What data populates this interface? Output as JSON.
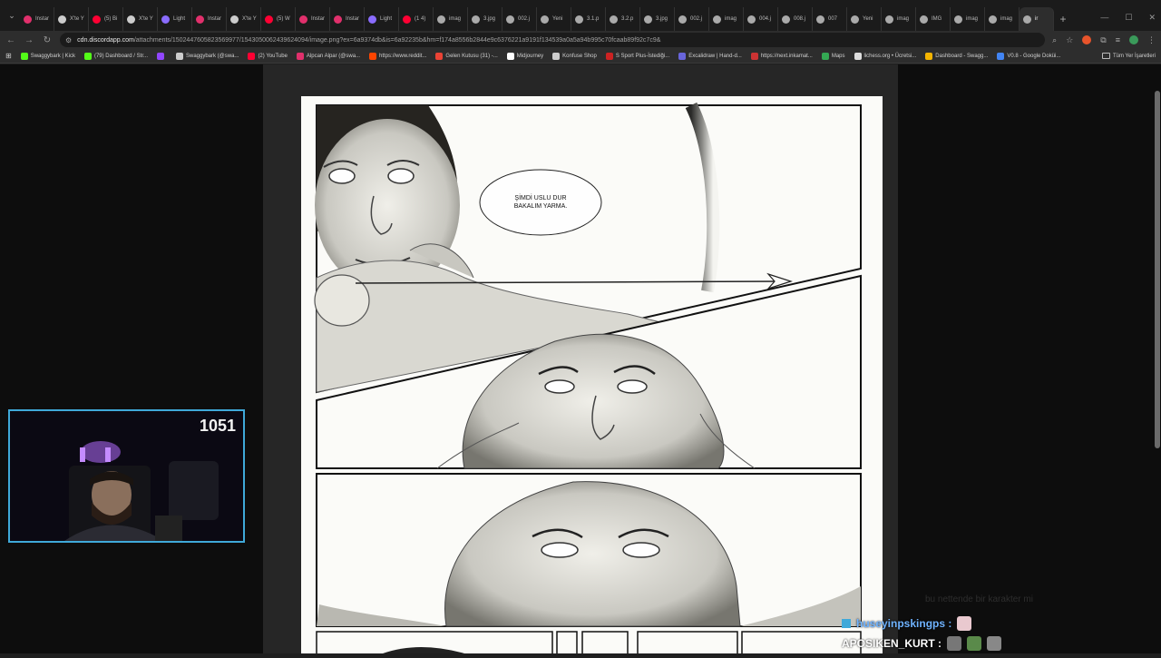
{
  "tabs": [
    {
      "label": "Instar",
      "color": "#e1306c"
    },
    {
      "label": "X'te Y",
      "color": "#cccccc"
    },
    {
      "label": "(5) Bi",
      "color": "#ff0033"
    },
    {
      "label": "X'te Y",
      "color": "#cccccc"
    },
    {
      "label": "Light",
      "color": "#8a6cff"
    },
    {
      "label": "Instar",
      "color": "#e1306c"
    },
    {
      "label": "X'te Y",
      "color": "#cccccc"
    },
    {
      "label": "(5) W",
      "color": "#ff0033"
    },
    {
      "label": "Instar",
      "color": "#e1306c"
    },
    {
      "label": "Instar",
      "color": "#e1306c"
    },
    {
      "label": "Light",
      "color": "#8a6cff"
    },
    {
      "label": "(1 4)",
      "color": "#ff0033"
    },
    {
      "label": "imag",
      "color": "#aaaaaa"
    },
    {
      "label": "3.jpg",
      "color": "#aaaaaa"
    },
    {
      "label": "002.j",
      "color": "#aaaaaa"
    },
    {
      "label": "Yeni",
      "color": "#aaaaaa"
    },
    {
      "label": "3.1.p",
      "color": "#aaaaaa"
    },
    {
      "label": "3.2.p",
      "color": "#aaaaaa"
    },
    {
      "label": "3.jpg",
      "color": "#aaaaaa"
    },
    {
      "label": "002.j",
      "color": "#aaaaaa"
    },
    {
      "label": "imag",
      "color": "#aaaaaa"
    },
    {
      "label": "004.j",
      "color": "#aaaaaa"
    },
    {
      "label": "008.j",
      "color": "#aaaaaa"
    },
    {
      "label": "007",
      "color": "#aaaaaa"
    },
    {
      "label": "Yeni",
      "color": "#aaaaaa"
    },
    {
      "label": "imag",
      "color": "#aaaaaa"
    },
    {
      "label": "IMG",
      "color": "#aaaaaa"
    },
    {
      "label": "imag",
      "color": "#aaaaaa"
    },
    {
      "label": "imag",
      "color": "#aaaaaa"
    },
    {
      "label": "ir",
      "color": "#aaaaaa",
      "active": true
    }
  ],
  "address": {
    "host": "cdn.discordapp.com",
    "path": "/attachments/1502447605823569977/1543050062439624094/image.png?ex=6a9374db&is=6a92235b&hm=f174a8556b2844e9c6376221a9191f134539a0a5a94b995c70fcaab89f92c7c9&"
  },
  "bookmarks": [
    {
      "label": "Swaggybark | Kick",
      "color": "#53fc18"
    },
    {
      "label": "(79) Dashboard / Str...",
      "color": "#53fc18"
    },
    {
      "label": "",
      "color": "#9146ff"
    },
    {
      "label": "Swaggybark (@swa...",
      "color": "#cccccc"
    },
    {
      "label": "(2) YouTube",
      "color": "#ff0033"
    },
    {
      "label": "Alpcan Alpar (@swa...",
      "color": "#e1306c"
    },
    {
      "label": "https://www.reddit...",
      "color": "#ff4500"
    },
    {
      "label": "Gelen Kutusu (31) -...",
      "color": "#ea4335"
    },
    {
      "label": "Midjourney",
      "color": "#ffffff"
    },
    {
      "label": "Konfuse Shop",
      "color": "#cccccc"
    },
    {
      "label": "S Sport Plus-İstediği...",
      "color": "#cc2222"
    },
    {
      "label": "Excalidraw | Hand-d...",
      "color": "#6965db"
    },
    {
      "label": "https://next.inkamat...",
      "color": "#cc3333"
    },
    {
      "label": "Maps",
      "color": "#34a853"
    },
    {
      "label": "lichess.org • Ücretsi...",
      "color": "#dddddd"
    },
    {
      "label": "Dashboard - Swagg...",
      "color": "#f4b400"
    },
    {
      "label": "V0.8 - Google Doküi...",
      "color": "#4285f4"
    }
  ],
  "bookmarks_right": "Tüm Yer İşaretleri",
  "comic": {
    "speech_line1": "ŞİMDİ USLU DUR",
    "speech_line2": "BAKALIM YARMA."
  },
  "webcam": {
    "count": "1051"
  },
  "chat": [
    {
      "user": "huseyinpskingps :",
      "color": "#6fb3ff"
    },
    {
      "user": "APOSIKEN_KURT :",
      "color": "#ffffff"
    }
  ],
  "chat_faded": "bu nettende bir karakter mi"
}
